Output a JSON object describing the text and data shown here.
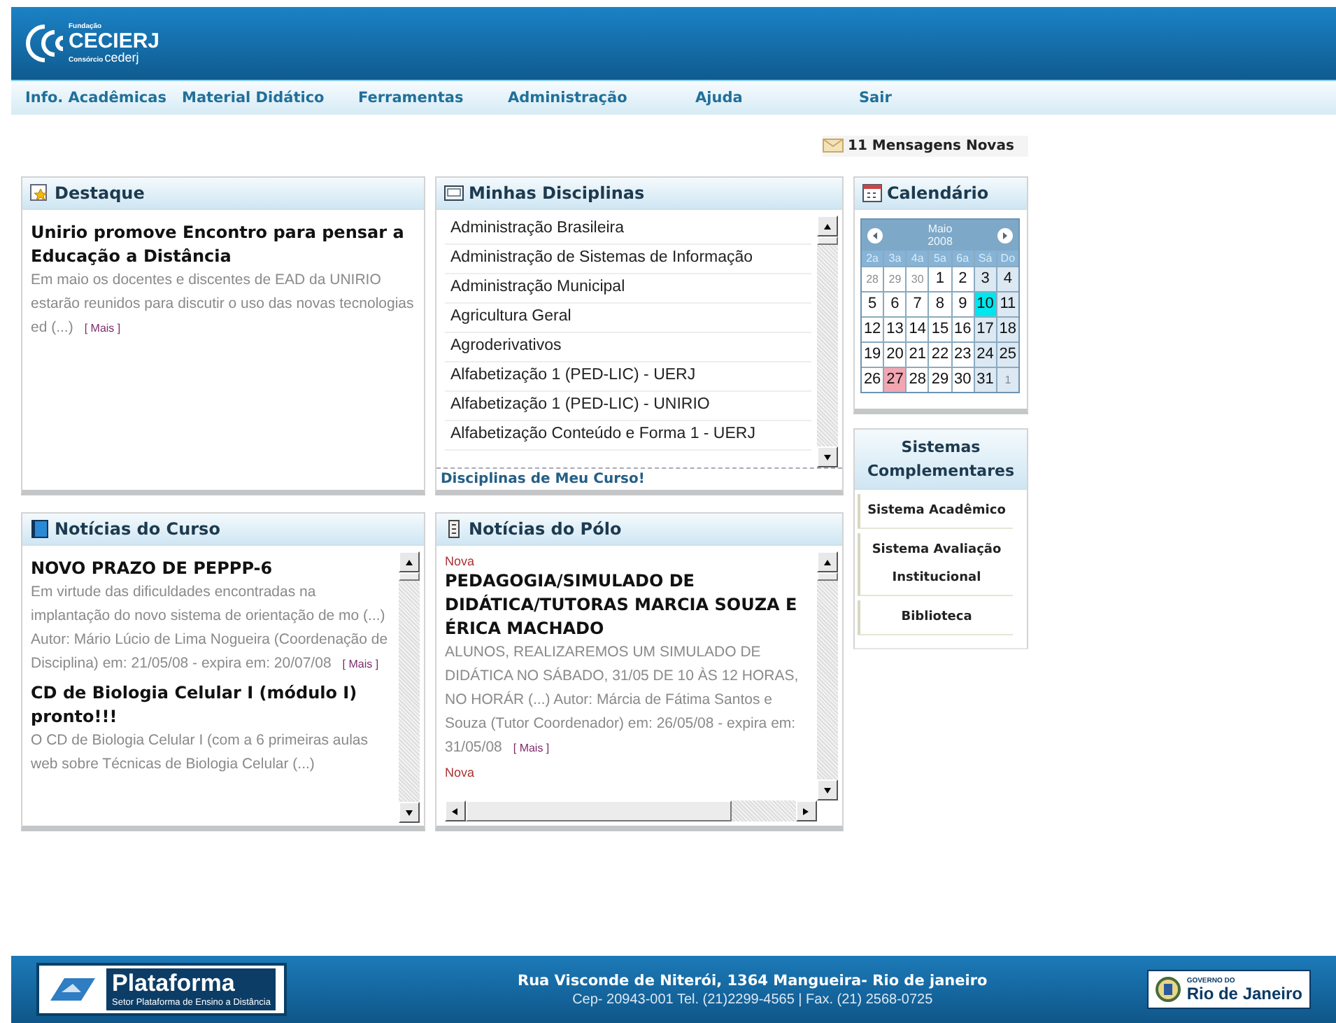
{
  "header": {
    "logo": {
      "top": "Fundação",
      "main": "CECIERJ",
      "sub_label": "Consórcio",
      "sub_brand": "cederj"
    },
    "nav": [
      "Info. Acadêmicas",
      "Material Didático",
      "Ferramentas",
      "Administração",
      "Ajuda",
      "Sair"
    ],
    "messages": "11 Mensagens Novas"
  },
  "destaque": {
    "title": "Destaque",
    "headline": "Unirio promove Encontro para pensar a Educação a Distância",
    "body": "Em maio os docentes e discentes de EAD da UNIRIO estarão reunidos para discutir o uso das novas tecnologias ed (...)",
    "more": "[ Mais ]"
  },
  "disciplinas": {
    "title": "Minhas Disciplinas",
    "items": [
      "Administração Brasileira",
      "Administração de Sistemas de Informação",
      "Administração Municipal",
      "Agricultura Geral",
      "Agroderivativos",
      "Alfabetização 1 (PED-LIC) - UERJ",
      "Alfabetização 1 (PED-LIC) - UNIRIO",
      "Alfabetização Conteúdo e Forma 1 - UERJ"
    ],
    "footer_link": "Disciplinas de Meu Curso!"
  },
  "noticias_curso": {
    "title": "Notícias do Curso",
    "items": [
      {
        "headline": "NOVO PRAZO DE PEPPP-6",
        "body": "Em virtude das dificuldades encontradas na implantação do novo sistema de orientação de mo (...) Autor: Mário Lúcio de Lima Nogueira (Coordenação de Disciplina) em: 21/05/08 - expira em: 20/07/08",
        "more": "[ Mais ]"
      },
      {
        "headline": "CD de Biologia Celular I (módulo I) pronto!!!",
        "body": "O CD de Biologia Celular I (com a 6 primeiras aulas web sobre Técnicas de Biologia Celular (...)"
      }
    ]
  },
  "noticias_polo": {
    "title": "Notícias do Pólo",
    "items": [
      {
        "tag": "Nova",
        "headline": "PEDAGOGIA/SIMULADO DE DIDÁTICA/TUTORAS MARCIA SOUZA E ÉRICA MACHADO",
        "body": "ALUNOS, REALIZAREMOS UM SIMULADO DE DIDÁTICA NO SÁBADO, 31/05 DE 10 ÀS 12 HORAS, NO HORÁR (...) Autor: Márcia de Fátima Santos e Souza (Tutor Coordenador) em: 26/05/08 - expira em: 31/05/08",
        "more": "[ Mais ]"
      },
      {
        "tag": "Nova"
      }
    ]
  },
  "calendario": {
    "title": "Calendário",
    "month": "Maio",
    "year": "2008",
    "weekdays": [
      "2a",
      "3a",
      "4a",
      "5a",
      "6a",
      "Sá",
      "Do"
    ],
    "days": [
      {
        "label": "28",
        "kind": "other"
      },
      {
        "label": "29",
        "kind": "other"
      },
      {
        "label": "30",
        "kind": "other"
      },
      {
        "label": "1",
        "kind": "day"
      },
      {
        "label": "2",
        "kind": "day"
      },
      {
        "label": "3",
        "kind": "weekend"
      },
      {
        "label": "4",
        "kind": "weekend"
      },
      {
        "label": "5",
        "kind": "day"
      },
      {
        "label": "6",
        "kind": "day"
      },
      {
        "label": "7",
        "kind": "day"
      },
      {
        "label": "8",
        "kind": "day"
      },
      {
        "label": "9",
        "kind": "day"
      },
      {
        "label": "10",
        "kind": "today"
      },
      {
        "label": "11",
        "kind": "weekend"
      },
      {
        "label": "12",
        "kind": "day"
      },
      {
        "label": "13",
        "kind": "day"
      },
      {
        "label": "14",
        "kind": "day"
      },
      {
        "label": "15",
        "kind": "day"
      },
      {
        "label": "16",
        "kind": "day"
      },
      {
        "label": "17",
        "kind": "weekend"
      },
      {
        "label": "18",
        "kind": "weekend"
      },
      {
        "label": "19",
        "kind": "day"
      },
      {
        "label": "20",
        "kind": "day"
      },
      {
        "label": "21",
        "kind": "day"
      },
      {
        "label": "22",
        "kind": "day"
      },
      {
        "label": "23",
        "kind": "day"
      },
      {
        "label": "24",
        "kind": "weekend"
      },
      {
        "label": "25",
        "kind": "weekend"
      },
      {
        "label": "26",
        "kind": "day"
      },
      {
        "label": "27",
        "kind": "selected"
      },
      {
        "label": "28",
        "kind": "day"
      },
      {
        "label": "29",
        "kind": "day"
      },
      {
        "label": "30",
        "kind": "day"
      },
      {
        "label": "31",
        "kind": "weekend"
      },
      {
        "label": "1",
        "kind": "other_weekend"
      }
    ]
  },
  "sistemas": {
    "title": "Sistemas Complementares",
    "links": [
      "Sistema Acadêmico",
      "Sistema Avaliação Institucional",
      "Biblioteca"
    ]
  },
  "footer": {
    "brand_name": "Plataforma",
    "brand_sub": "Setor Plataforma de Ensino a Distância",
    "address": "Rua Visconde de Niterói, 1364 Mangueira- Rio de janeiro",
    "contacts": "Cep- 20943-001 Tel. (21)2299-4565 | Fax. (21) 2568-0725",
    "gov_top": "GOVERNO DO",
    "gov_name": "Rio de Janeiro"
  }
}
